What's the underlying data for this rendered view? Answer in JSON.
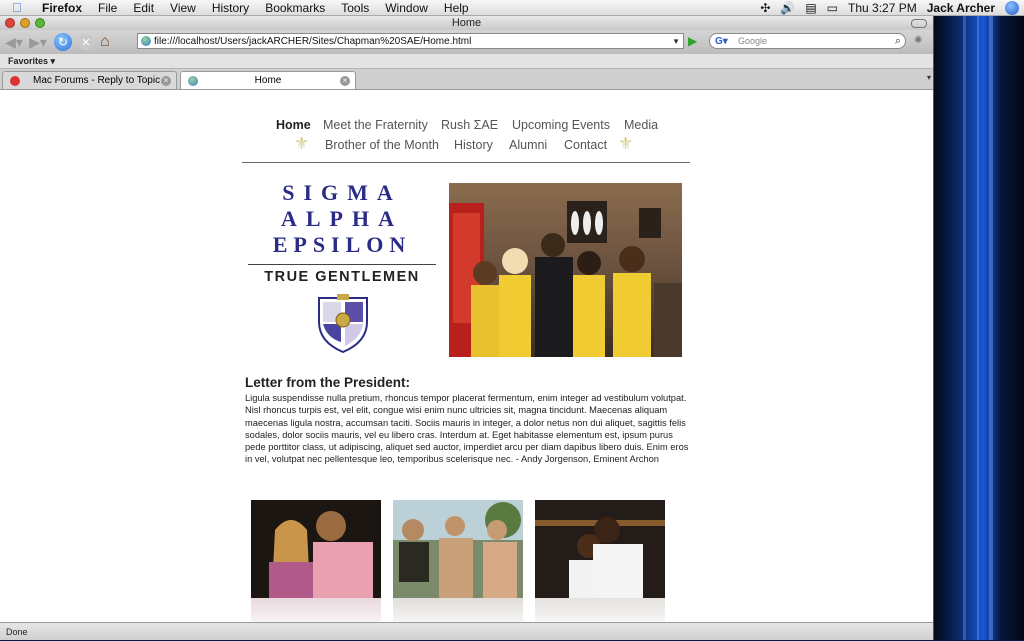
{
  "menubar": {
    "app_name": "Firefox",
    "items": [
      "File",
      "Edit",
      "View",
      "History",
      "Bookmarks",
      "Tools",
      "Window",
      "Help"
    ],
    "clock": "Thu 3:27 PM",
    "user": "Jack Archer"
  },
  "window": {
    "title": "Home"
  },
  "toolbar": {
    "url": "file:///localhost/Users/jackARCHER/Sites/Chapman%20SAE/Home.html",
    "search_placeholder": "Google"
  },
  "favorites": {
    "label": "Favorites ▾"
  },
  "tabs": [
    {
      "label": "Mac Forums - Reply to Topic"
    },
    {
      "label": "Home"
    }
  ],
  "site": {
    "nav": {
      "home": "Home",
      "meet": "Meet the Fraternity",
      "rush": "Rush ΣΑΕ",
      "events": "Upcoming Events",
      "media": "Media",
      "brother": "Brother of the Month",
      "history": "History",
      "alumni": "Alumni",
      "contact": "Contact"
    },
    "logo": {
      "line1": "SIGMA",
      "line2": "ALPHA",
      "line3": "EPSILON",
      "tagline": "TRUE GENTLEMEN"
    },
    "letter_heading": "Letter from the President:",
    "letter_body": "Ligula suspendisse nulla pretium, rhoncus tempor placerat fermentum, enim integer ad vestibulum volutpat. Nisl rhoncus turpis est, vel elit, congue wisi enim nunc ultricies sit, magna tincidunt. Maecenas aliquam maecenas ligula nostra, accumsan taciti. Sociis mauris in integer, a dolor netus non dui aliquet, sagittis felis sodales, dolor sociis mauris, vel eu libero cras. Interdum at. Eget habitasse elementum est, ipsum purus pede porttitor class, ut adipiscing, aliquet sed auctor, imperdiet arcu per diam dapibus libero duis. Enim eros in vel, volutpat nec pellentesque leo, temporibus scelerisque nec. - Andy Jorgenson, Eminent Archon"
  },
  "status": {
    "text": "Done"
  },
  "colors": {
    "logo_blue": "#2b2c86",
    "fleur_gold": "#d9c88a"
  }
}
